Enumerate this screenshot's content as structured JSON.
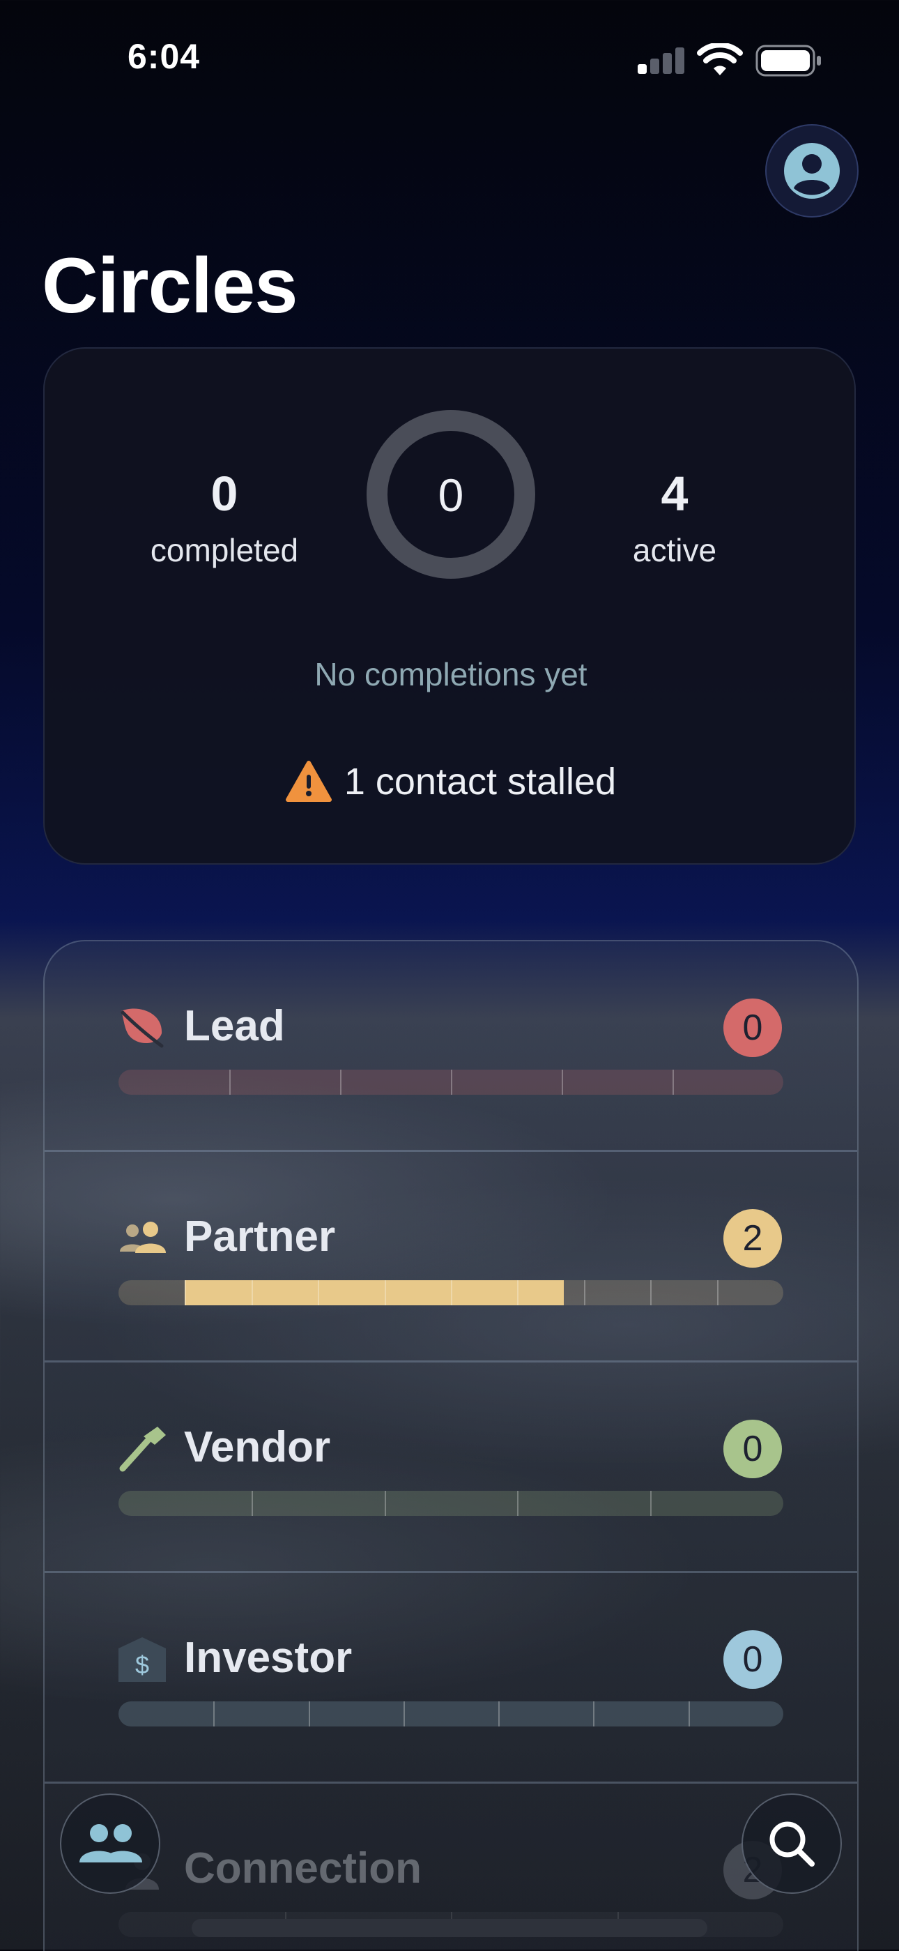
{
  "status_bar": {
    "time": "6:04",
    "icons": [
      "cellular-signal-icon",
      "wifi-icon",
      "battery-icon"
    ]
  },
  "header": {
    "title": "Circles",
    "profile_icon": "profile-icon"
  },
  "summary": {
    "completed_value": "0",
    "completed_label": "completed",
    "ring_value": "0",
    "active_value": "4",
    "active_label": "active",
    "no_completions_text": "No completions yet",
    "stalled_text": "1 contact stalled",
    "stalled_icon": "warning-icon"
  },
  "circles": [
    {
      "label": "Lead",
      "count": "0",
      "icon": "leaf-icon",
      "color": "#d46a6a",
      "progress": 0,
      "segments": 6
    },
    {
      "label": "Partner",
      "count": "2",
      "icon": "people-icon",
      "color": "#e8c98a",
      "progress": 0.67,
      "segments": 10
    },
    {
      "label": "Vendor",
      "count": "0",
      "icon": "hammer-icon",
      "color": "#a8c48c",
      "progress": 0,
      "segments": 5
    },
    {
      "label": "Investor",
      "count": "0",
      "icon": "bank-icon",
      "color": "#9ec8dc",
      "progress": 0,
      "segments": 7
    },
    {
      "label": "Connection",
      "count": "2",
      "icon": "person-icon",
      "color": "#8a8f99",
      "progress": 0,
      "segments": 4
    }
  ],
  "bottom_bar": {
    "left_icon": "circles-people-icon",
    "right_icon": "search-icon"
  }
}
